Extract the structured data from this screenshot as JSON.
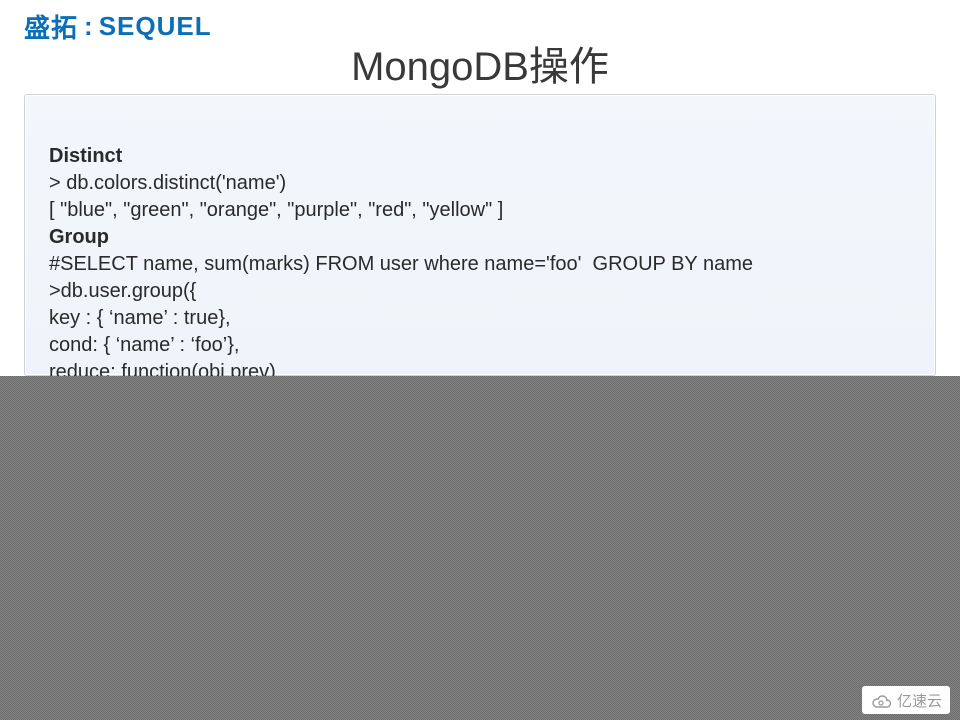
{
  "logo": {
    "cn": "盛拓",
    "colon": ":",
    "en": "SEQUEL"
  },
  "title": "MongoDB操作",
  "code": {
    "l1": "Distinct",
    "l2": "> db.colors.distinct('name')",
    "l3": "[ \"blue\", \"green\", \"orange\", \"purple\", \"red\", \"yellow\" ]",
    "l4": "Group",
    "l5": "#SELECT name, sum(marks) FROM user where name='foo'  GROUP BY name",
    "l6": ">db.user.group({",
    "l7": "key : { ‘name’ : true},",
    "l8": "cond: { ‘name’ : ‘foo’},",
    "l9": "reduce: function(obj,prev)"
  },
  "watermark": {
    "text": "亿速云"
  }
}
